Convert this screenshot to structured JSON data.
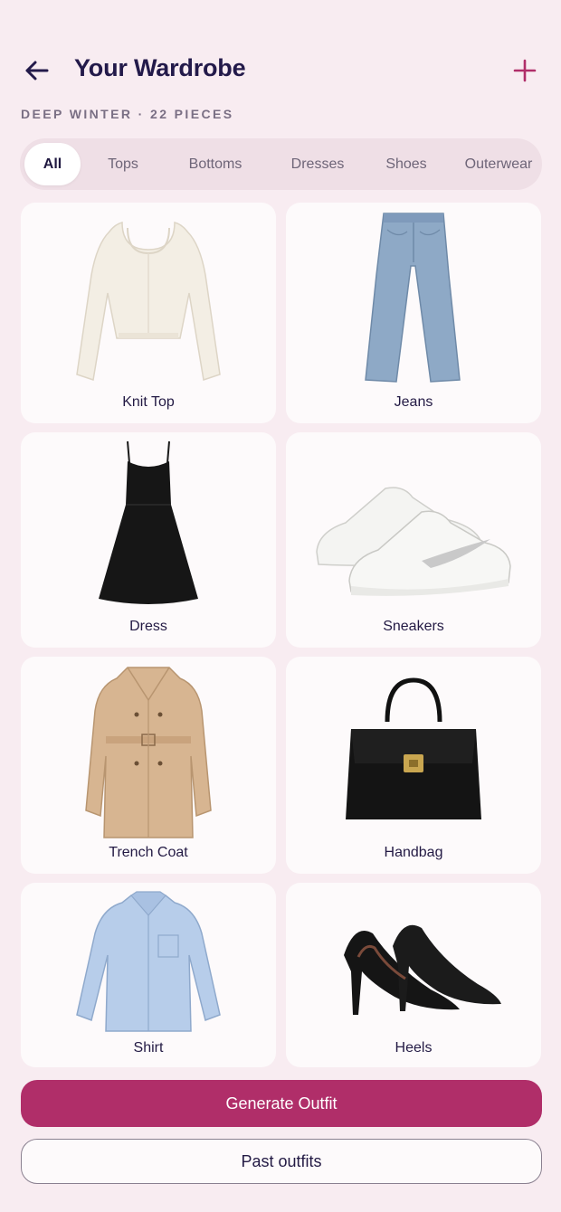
{
  "header": {
    "title": "Your Wardrobe",
    "back_icon": "arrow-left-icon",
    "add_icon": "plus-icon",
    "subtitle": "DEEP WINTER · 22 PIECES"
  },
  "tabs": [
    {
      "label": "All",
      "active": true
    },
    {
      "label": "Tops",
      "active": false
    },
    {
      "label": "Bottoms",
      "active": false
    },
    {
      "label": "Dresses",
      "active": false
    },
    {
      "label": "Shoes",
      "active": false
    },
    {
      "label": "Outerwear",
      "active": false
    }
  ],
  "items": [
    {
      "label": "Knit Top",
      "icon": "knit-top-icon"
    },
    {
      "label": "Jeans",
      "icon": "jeans-icon"
    },
    {
      "label": "Dress",
      "icon": "dress-icon"
    },
    {
      "label": "Sneakers",
      "icon": "sneakers-icon"
    },
    {
      "label": "Trench Coat",
      "icon": "trench-coat-icon"
    },
    {
      "label": "Handbag",
      "icon": "handbag-icon"
    },
    {
      "label": "Shirt",
      "icon": "shirt-icon"
    },
    {
      "label": "Heels",
      "icon": "heels-icon"
    }
  ],
  "actions": {
    "generate_label": "Generate Outfit",
    "past_label": "Past outfits"
  },
  "colors": {
    "background": "#f8ecf1",
    "accent": "#b02e69",
    "text": "#231a44"
  }
}
